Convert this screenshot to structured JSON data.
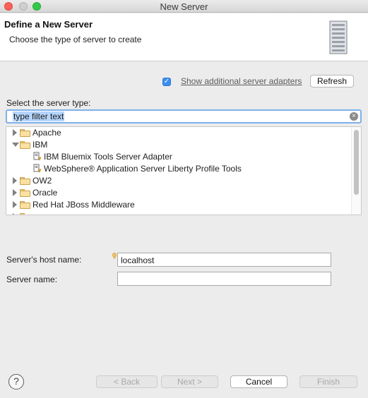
{
  "window": {
    "title": "New Server"
  },
  "banner": {
    "title": "Define a New Server",
    "description": "Choose the type of server to create"
  },
  "adapters": {
    "checked": true,
    "label": "Show additional server adapters",
    "refresh_label": "Refresh"
  },
  "server_type": {
    "label": "Select the server type:",
    "filter_value": "type filter text",
    "tree": [
      {
        "label": "Apache",
        "kind": "folder",
        "expanded": false
      },
      {
        "label": "IBM",
        "kind": "folder",
        "expanded": true
      },
      {
        "label": "IBM Bluemix Tools Server Adapter",
        "kind": "adapter"
      },
      {
        "label": "WebSphere® Application Server Liberty Profile Tools",
        "kind": "adapter"
      },
      {
        "label": "OW2",
        "kind": "folder",
        "expanded": false
      },
      {
        "label": "Oracle",
        "kind": "folder",
        "expanded": false
      },
      {
        "label": "Red Hat JBoss Middleware",
        "kind": "folder",
        "expanded": false
      }
    ]
  },
  "host": {
    "label": "Server's host name:",
    "value": "localhost"
  },
  "server_name": {
    "label": "Server name:",
    "value": ""
  },
  "footer": {
    "help": "?",
    "back": "< Back",
    "next": "Next >",
    "cancel": "Cancel",
    "finish": "Finish"
  },
  "colors": {
    "accent": "#3b8ef2",
    "focus_ring": "#7eb1ea",
    "selection": "#b5d5fb"
  }
}
